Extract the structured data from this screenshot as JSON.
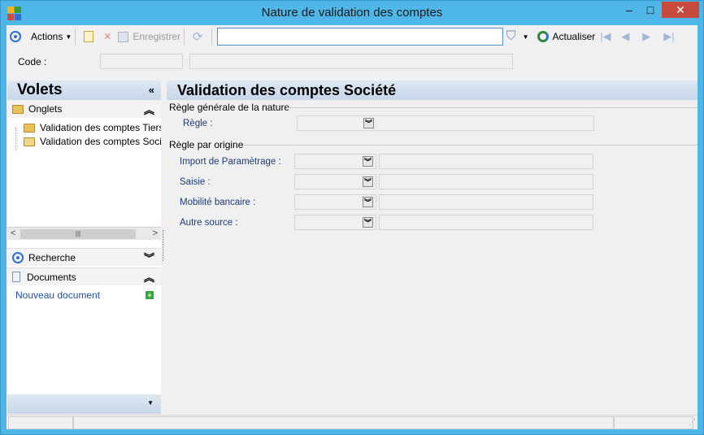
{
  "window": {
    "title": "Nature de validation des comptes",
    "minimize_symbol": "–",
    "maximize_symbol": "□",
    "close_symbol": "✕",
    "accent_color": "#4fb6e8"
  },
  "toolbar": {
    "actions_label": "Actions",
    "save_label": "Enregistrer",
    "search_value": "",
    "refresh_label": "Actualiser"
  },
  "code_row": {
    "label": "Code :",
    "value": "",
    "description": ""
  },
  "left_pane": {
    "title": "Volets",
    "tabs_section": "Onglets",
    "tabs": [
      {
        "label": "Validation des comptes Tiers"
      },
      {
        "label": "Validation des comptes Société"
      }
    ],
    "search_section": "Recherche",
    "documents_section": "Documents",
    "new_document": "Nouveau document"
  },
  "main": {
    "title": "Validation des comptes Société",
    "general_group": {
      "title": "Règle générale de la nature",
      "rule_label": "Règle :",
      "rule_value": ""
    },
    "origin_group": {
      "title": "Règle par origine",
      "rows": [
        {
          "label": "Import de Paramètrage :",
          "value": "",
          "detail": ""
        },
        {
          "label": "Saisie :",
          "value": "",
          "detail": ""
        },
        {
          "label": "Mobilité bancaire :",
          "value": "",
          "detail": ""
        },
        {
          "label": "Autre source :",
          "value": "",
          "detail": ""
        }
      ]
    }
  }
}
